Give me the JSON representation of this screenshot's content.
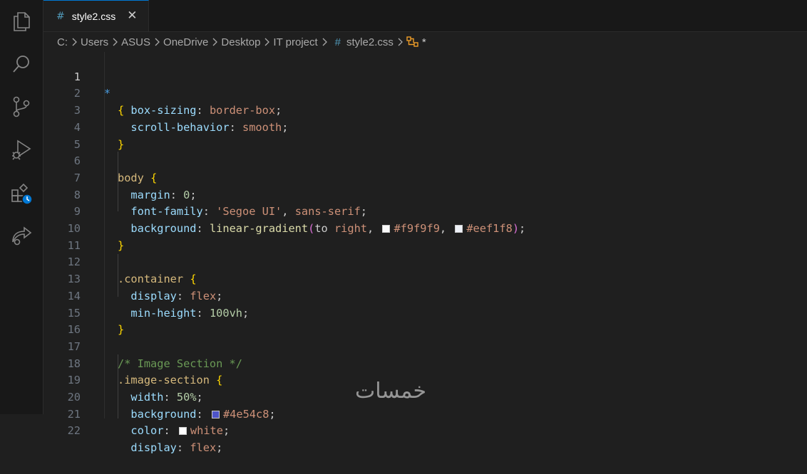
{
  "activity_bar": {
    "icons": [
      "files-icon",
      "search-icon",
      "source-control-icon",
      "run-debug-icon",
      "extensions-icon",
      "remote-icon"
    ]
  },
  "tab": {
    "icon": "#",
    "label": "style2.css",
    "close": "✕"
  },
  "breadcrumb": {
    "items": [
      "C:",
      "Users",
      "ASUS",
      "OneDrive",
      "Desktop",
      "IT project"
    ],
    "file_icon": "#",
    "file": "style2.css",
    "symbol_icon": "selector-icon",
    "symbol": "*"
  },
  "editor": {
    "modified_marker": "*",
    "line_numbers": [
      "1",
      "2",
      "3",
      "4",
      "5",
      "6",
      "7",
      "8",
      "9",
      "10",
      "11",
      "12",
      "13",
      "14",
      "15",
      "16",
      "17",
      "18",
      "19",
      "20",
      "21",
      "22"
    ],
    "lines": {
      "l1_sel": "{",
      "l2_prop": "box-sizing",
      "l2_val": "border-box",
      "l3_prop": "scroll-behavior",
      "l3_val": "smooth",
      "l4": "}",
      "l6_sel": "body",
      "l6_br": "{",
      "l7_prop": "margin",
      "l7_val": "0",
      "l8_prop": "font-family",
      "l8_val1": "'Segoe UI'",
      "l8_val2": "sans-serif",
      "l9_prop": "background",
      "l9_fn": "linear-gradient",
      "l9_to": "to",
      "l9_dir": "right",
      "l9_c1": "#f9f9f9",
      "l9_c2": "#eef1f8",
      "l10": "}",
      "l12_sel": ".container",
      "l12_br": "{",
      "l13_prop": "display",
      "l13_val": "flex",
      "l14_prop": "min-height",
      "l14_val": "100vh",
      "l15": "}",
      "l17_cmt": "/* Image Section */",
      "l18_sel": ".image-section",
      "l18_br": "{",
      "l19_prop": "width",
      "l19_val": "50%",
      "l20_prop": "background",
      "l20_val": "#4e54c8",
      "l21_prop": "color",
      "l21_val": "white",
      "l22_prop": "display",
      "l22_val": "flex"
    }
  },
  "colors": {
    "swatch_f9f9f9": "#f9f9f9",
    "swatch_eef1f8": "#eef1f8",
    "swatch_4e54c8": "#4e54c8",
    "swatch_white": "#ffffff"
  },
  "watermark": "خمسات"
}
